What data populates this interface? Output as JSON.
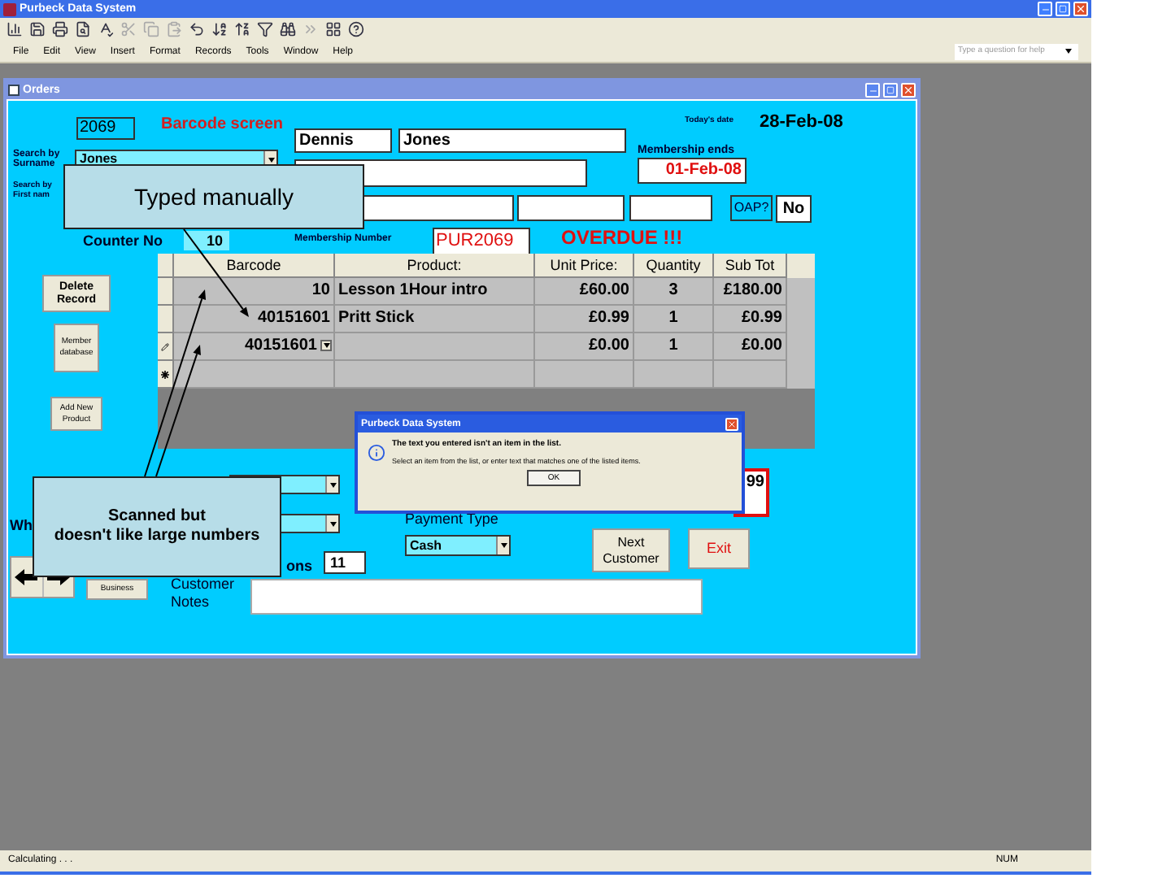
{
  "app": {
    "title": "Purbeck Data System"
  },
  "menu": [
    "File",
    "Edit",
    "View",
    "Insert",
    "Format",
    "Records",
    "Tools",
    "Window",
    "Help"
  ],
  "help_box": {
    "placeholder": "Type a question for help"
  },
  "form": {
    "title": "Orders",
    "order_number": "2069",
    "heading": "Barcode screen",
    "first_name": "Dennis",
    "surname": "Jones",
    "todays_date_label": "Today's date",
    "todays_date": "28-Feb-08",
    "search_surname_label": "Search by Surname",
    "search_surname": "Jones",
    "search_first_label": "Search by First nam",
    "membership_ends_label": "Membership ends",
    "membership_ends": "01-Feb-08",
    "oap_label": "OAP?",
    "oap": "No",
    "counter_label": "Counter No",
    "counter": "10",
    "membership_number_label": "Membership Number",
    "membership_number": "PUR2069",
    "status": "OVERDUE !!!",
    "buttons": [
      "Delete Record",
      "Member database",
      "Add New Product"
    ],
    "table": {
      "columns": [
        "Barcode",
        "Product:",
        "Unit Price:",
        "Quantity",
        "Sub Tot"
      ],
      "rows": [
        {
          "kind": "record",
          "cells": [
            "10",
            "Lesson 1Hour intro",
            "£60.00",
            "3",
            "£180.00"
          ]
        },
        {
          "kind": "record",
          "cells": [
            "40151601",
            "Pritt Stick",
            "£0.99",
            "1",
            "£0.99"
          ]
        },
        {
          "kind": "editing",
          "cells": [
            "40151601",
            "",
            "£0.00",
            "1",
            "£0.00"
          ]
        },
        {
          "kind": "new",
          "cells": [
            "",
            "",
            "",
            "",
            ""
          ]
        }
      ]
    },
    "which_label": "Wh",
    "sessions_label": "ons",
    "sessions": "11",
    "total_partial": "99",
    "payment_label": "Payment Type",
    "payment": "Cash",
    "next_button": "Next Customer",
    "exit_button": "Exit",
    "business_button": "Business",
    "notes_label": "Customer Notes"
  },
  "dialog": {
    "title": "Purbeck Data System",
    "message": "The text you entered isn't an item in the list.",
    "detail": "Select an item from the list, or enter text that matches one of the listed items.",
    "button": "OK"
  },
  "callouts": [
    {
      "lines": [
        "Typed manually"
      ]
    },
    {
      "lines": [
        "Scanned but",
        "doesn't like large numbers"
      ]
    }
  ],
  "status_bar": {
    "left": "Calculating . . .",
    "right": "NUM"
  }
}
